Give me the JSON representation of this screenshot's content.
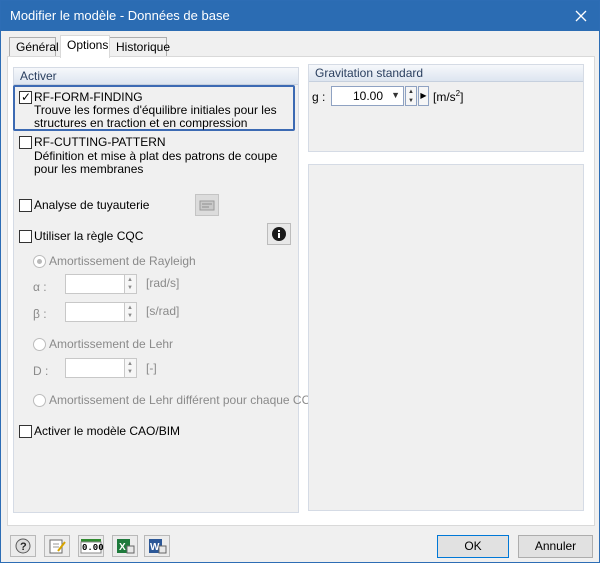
{
  "window": {
    "title": "Modifier le modèle - Données de base"
  },
  "tabs": [
    {
      "label": "Général"
    },
    {
      "label": "Options"
    },
    {
      "label": "Historique"
    }
  ],
  "activer": {
    "header": "Activer",
    "rf_form_finding": {
      "label": "RF-FORM-FINDING",
      "desc1": "Trouve les formes d'équilibre initiales pour les",
      "desc2": "structures en traction et en compression",
      "checked": true
    },
    "rf_cutting_pattern": {
      "label": "RF-CUTTING-PATTERN",
      "desc1": "Définition et mise à plat des patrons de coupe",
      "desc2": "pour les membranes",
      "checked": false
    },
    "analyse_tuyauterie": {
      "label": "Analyse de tuyauterie",
      "checked": false
    },
    "cqc": {
      "label": "Utiliser la règle CQC",
      "checked": false
    },
    "rayleigh": {
      "label": "Amortissement de Rayleigh"
    },
    "alpha": {
      "symbol": "α :",
      "unit": "[rad/s]"
    },
    "beta": {
      "symbol": "β :",
      "unit": "[s/rad]"
    },
    "lehr": {
      "label": "Amortissement de Lehr"
    },
    "d": {
      "symbol": "D :",
      "unit": "[-]"
    },
    "lehr_cc": {
      "label": "Amortissement de Lehr différent pour chaque CC"
    },
    "cao_bim": {
      "label": "Activer le modèle CAO/BIM",
      "checked": false
    }
  },
  "gravitation": {
    "header": "Gravitation standard",
    "symbol": "g :",
    "value": "10.00",
    "unit_base": "[m/s",
    "unit_exp": "2",
    "unit_close": "]"
  },
  "footer": {
    "ok": "OK",
    "cancel": "Annuler",
    "units_icon_text": "0.00"
  }
}
